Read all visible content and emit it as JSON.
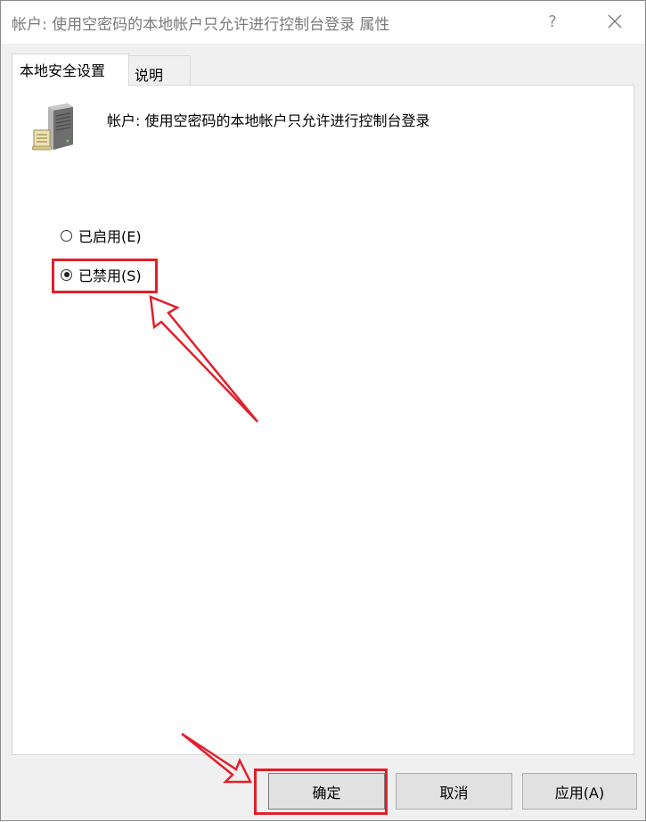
{
  "window": {
    "title": "帐户: 使用空密码的本地帐户只允许进行控制台登录 属性",
    "help_glyph": "?",
    "close_glyph": "✕"
  },
  "tabs": [
    {
      "label": "本地安全设置",
      "active": true
    },
    {
      "label": "说明",
      "active": false
    }
  ],
  "policy": {
    "icon": "server-icon",
    "title": "帐户: 使用空密码的本地帐户只允许进行控制台登录"
  },
  "options": {
    "enabled_label": "已启用(E)",
    "disabled_label": "已禁用(S)",
    "selected": "disabled"
  },
  "buttons": {
    "ok_label": "确定",
    "cancel_label": "取消",
    "apply_label": "应用(A)"
  },
  "colors": {
    "annotation": "#e0202c"
  }
}
